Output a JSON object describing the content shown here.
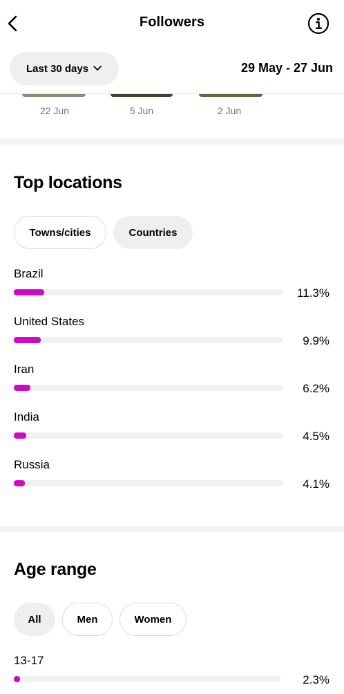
{
  "header": {
    "title": "Followers",
    "back_icon": "chevron-left-icon",
    "info_icon": "info-circle-icon"
  },
  "period": {
    "label": "Last 30 days",
    "chevron_icon": "chevron-down-icon",
    "date_range": "29 May - 27 Jun"
  },
  "thumbnails": [
    {
      "date": "22 Jun"
    },
    {
      "date": "5 Jun"
    },
    {
      "date": "2 Jun"
    }
  ],
  "top_locations": {
    "title": "Top locations",
    "tabs": [
      {
        "label": "Towns/cities",
        "selected": false
      },
      {
        "label": "Countries",
        "selected": true
      }
    ],
    "items": [
      {
        "name": "Brazil",
        "percent": "11.3%",
        "value": 11.3
      },
      {
        "name": "United States",
        "percent": "9.9%",
        "value": 9.9
      },
      {
        "name": "Iran",
        "percent": "6.2%",
        "value": 6.2
      },
      {
        "name": "India",
        "percent": "4.5%",
        "value": 4.5
      },
      {
        "name": "Russia",
        "percent": "4.1%",
        "value": 4.1
      }
    ],
    "bar_color": "#cc0ac7"
  },
  "age_range": {
    "title": "Age range",
    "tabs": [
      {
        "label": "All",
        "selected": true
      },
      {
        "label": "Men",
        "selected": false
      },
      {
        "label": "Women",
        "selected": false
      }
    ],
    "items": [
      {
        "name": "13-17",
        "percent": "2.3%",
        "value": 2.3
      }
    ]
  }
}
